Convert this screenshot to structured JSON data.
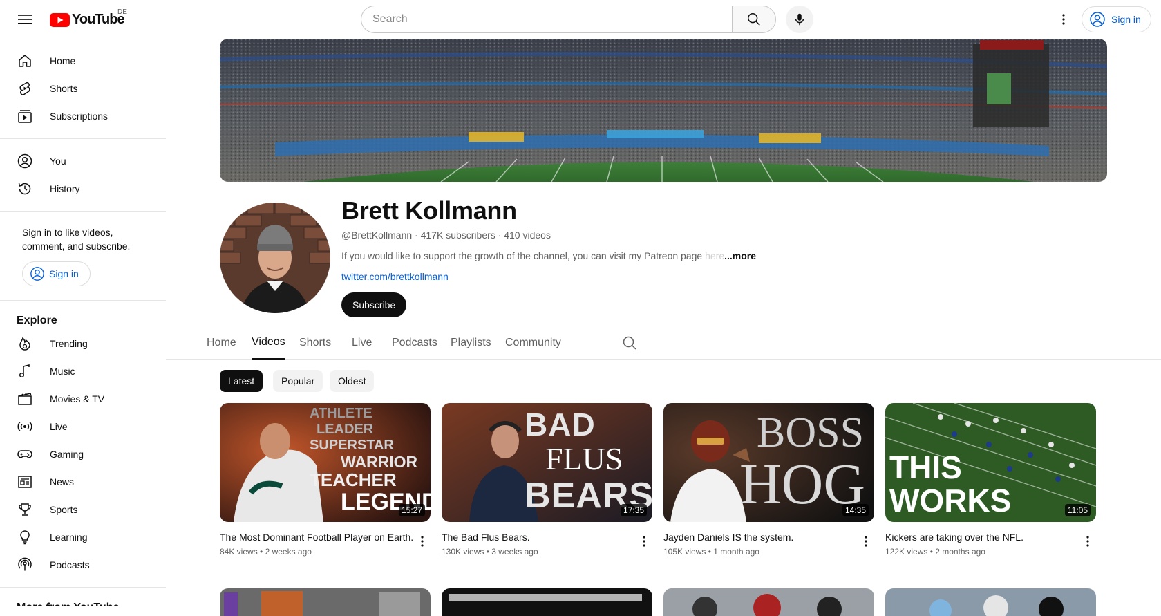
{
  "masthead": {
    "logo_text": "YouTube",
    "country": "DE",
    "search_placeholder": "Search",
    "sign_in": "Sign in"
  },
  "sidebar": {
    "main": [
      {
        "label": "Home",
        "icon": "home-icon"
      },
      {
        "label": "Shorts",
        "icon": "shorts-icon"
      },
      {
        "label": "Subscriptions",
        "icon": "subscriptions-icon"
      }
    ],
    "you": [
      {
        "label": "You",
        "icon": "you-icon"
      },
      {
        "label": "History",
        "icon": "history-icon"
      }
    ],
    "signin_prompt": "Sign in to like videos, comment, and subscribe.",
    "signin_button": "Sign in",
    "explore_heading": "Explore",
    "explore": [
      {
        "label": "Trending",
        "icon": "trending-icon"
      },
      {
        "label": "Music",
        "icon": "music-icon"
      },
      {
        "label": "Movies & TV",
        "icon": "movies-icon"
      },
      {
        "label": "Live",
        "icon": "live-icon"
      },
      {
        "label": "Gaming",
        "icon": "gaming-icon"
      },
      {
        "label": "News",
        "icon": "news-icon"
      },
      {
        "label": "Sports",
        "icon": "sports-icon"
      },
      {
        "label": "Learning",
        "icon": "learning-icon"
      },
      {
        "label": "Podcasts",
        "icon": "podcasts-icon"
      }
    ],
    "more_heading": "More from YouTube"
  },
  "channel": {
    "name": "Brett Kollmann",
    "handle": "@BrettKollmann",
    "subscribers": "417K subscribers",
    "videos": "410 videos",
    "meta_sep": " · ",
    "description": "If you would like to support the growth of the channel, you can visit my Patreon page ",
    "description_fade": "here",
    "more": "...more",
    "link": "twitter.com/brettkollmann",
    "subscribe": "Subscribe"
  },
  "tabs": [
    {
      "label": "Home",
      "active": false
    },
    {
      "label": "Videos",
      "active": true
    },
    {
      "label": "Shorts",
      "active": false
    },
    {
      "label": "Live",
      "active": false
    },
    {
      "label": "Podcasts",
      "active": false
    },
    {
      "label": "Playlists",
      "active": false
    },
    {
      "label": "Community",
      "active": false
    }
  ],
  "chips": [
    {
      "label": "Latest",
      "active": true
    },
    {
      "label": "Popular",
      "active": false
    },
    {
      "label": "Oldest",
      "active": false
    }
  ],
  "videos": [
    {
      "title": "The Most Dominant Football Player on Earth.",
      "views": "84K views",
      "age": "2 weeks ago",
      "duration": "15:27",
      "thumb_text": [
        "ATHLETE",
        "LEADER",
        "SUPERSTAR",
        "WARRIOR",
        "TEACHER",
        "LEGEND"
      ]
    },
    {
      "title": "The Bad Flus Bears.",
      "views": "130K views",
      "age": "3 weeks ago",
      "duration": "17:35",
      "thumb_text": [
        "BAD",
        "FLUS",
        "BEARS"
      ]
    },
    {
      "title": "Jayden Daniels IS the system.",
      "views": "105K views",
      "age": "1 month ago",
      "duration": "14:35",
      "thumb_text": [
        "BOSS",
        "HOG"
      ]
    },
    {
      "title": "Kickers are taking over the NFL.",
      "views": "122K views",
      "age": "2 months ago",
      "duration": "11:05",
      "thumb_text": [
        "THIS",
        "WORKS"
      ]
    }
  ]
}
